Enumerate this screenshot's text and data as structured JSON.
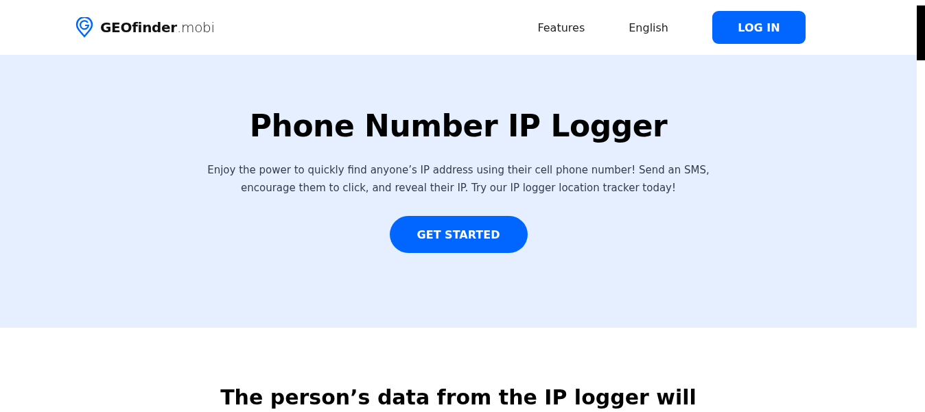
{
  "header": {
    "logo": "**GEOfinder**.mobi",
    "nav": [
      {
        "label": "Features"
      },
      {
        "label": "English"
      }
    ],
    "login": "LOG IN"
  },
  "hero": {
    "title": "Phone Number IP Logger",
    "text": "Enjoy the power to quickly find anyone’s IP address using their cell phone number! Send an SMS, encourage them to click, and reveal their IP. Try our IP logger location tracker today!",
    "button": "GET STARTED"
  },
  "section": {
    "title": "The person’s data from the IP logger will"
  }
}
